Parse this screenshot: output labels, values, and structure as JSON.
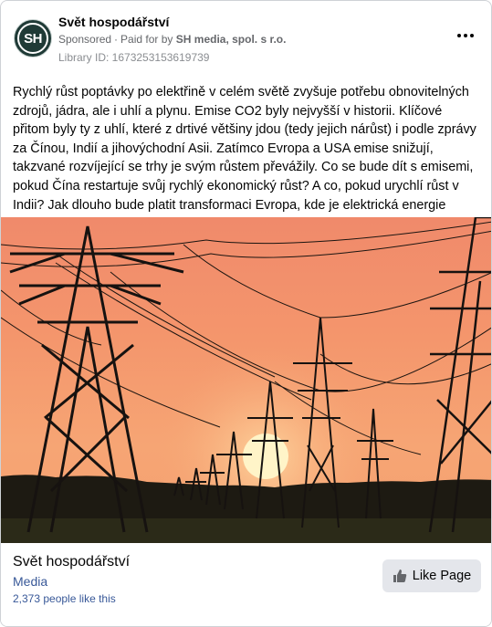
{
  "post": {
    "page_name": "Svět hospodářství",
    "avatar_initials": "SH",
    "sponsored": "Sponsored",
    "paid_for_prefix": "Paid for by",
    "paid_for_by": "SH media, spol. s r.o.",
    "library_id": "Library ID: 1673253153619739",
    "text": "Rychlý růst poptávky po elektřině v celém světě zvyšuje potřebu obnovitelných zdrojů, jádra, ale i uhlí a plynu. Emise CO2 byly nejvyšší v historii. Klíčové přitom byly ty z uhlí, které z drtivé většiny jdou (tedy jejich nárůst) i podle zprávy za Čínou, Indií a jihovýchodní Asii. Zatímco Evropa a USA emise snižují, takzvané rozvíjející se trhy je svým růstem převážily. Co se bude dít s emisemi, pokud Čína restartuje svůj rychlý ekonomický růst? A co, pokud urychlí růst v Indii? Jak dlouho bude platit transformaci Evropa, kde je elektrická energie extrémně drahá? Jak to, že s…"
  },
  "footer": {
    "page_name": "Svět hospodářství",
    "category": "Media",
    "likes": "2,373 people like this",
    "like_button": "Like Page"
  },
  "colors": {
    "avatar_bg": "#1f3a36",
    "link_blue": "#385898",
    "button_bg": "#e4e6eb",
    "sky_top": "#f0866a",
    "sun": "#fff3c4"
  }
}
